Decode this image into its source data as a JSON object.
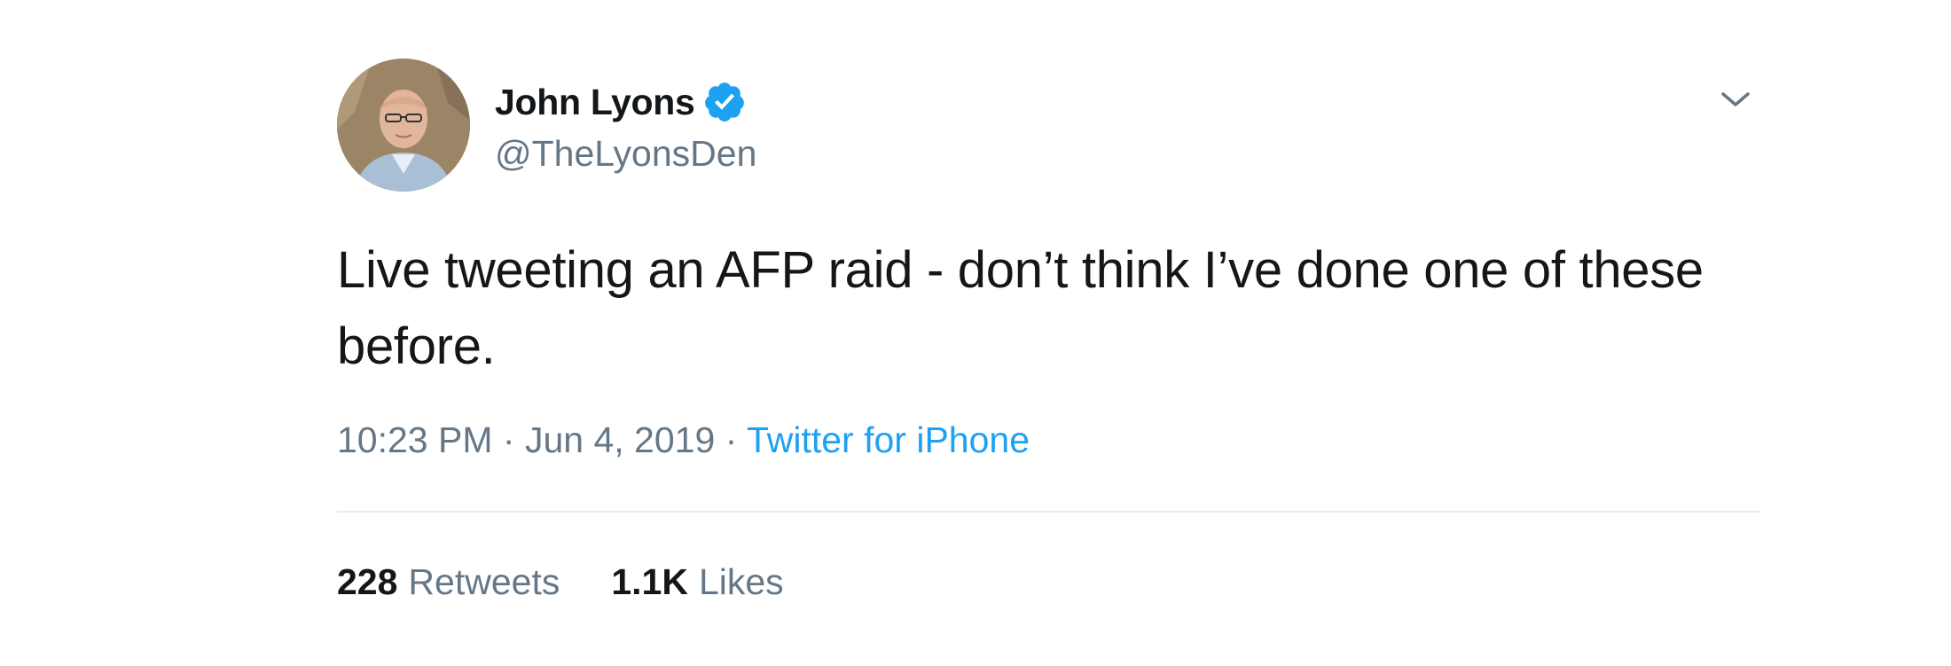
{
  "tweet": {
    "author": {
      "display_name": "John Lyons",
      "handle": "@TheLyonsDen",
      "verified": true,
      "verified_icon": "verified-badge-icon"
    },
    "menu_icon": "chevron-down-icon",
    "text": "Live tweeting an AFP raid - don’t think I’ve done one of these before.",
    "time": "10:23 PM",
    "separator": "·",
    "date": "Jun 4, 2019",
    "source": "Twitter for iPhone",
    "stats": {
      "retweets_count": "228",
      "retweets_label": "Retweets",
      "likes_count": "1.1K",
      "likes_label": "Likes"
    }
  },
  "colors": {
    "accent": "#1da1f2",
    "text_primary": "#14171a",
    "text_secondary": "#657786",
    "divider": "#e6ecf0"
  }
}
